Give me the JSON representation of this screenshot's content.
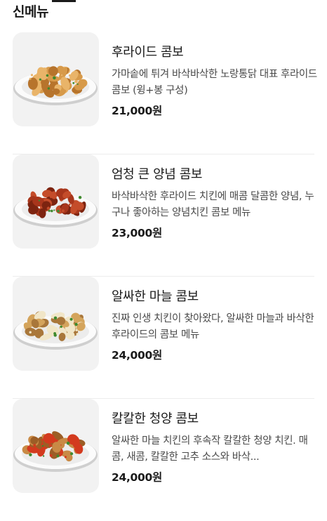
{
  "section": {
    "title": "신메뉴"
  },
  "menu": [
    {
      "name": "후라이드 콤보",
      "description": "가마솥에 튀겨 바삭바삭한 노랑통닭 대표 후라이드 콤보 (윙+봉 구성)",
      "price": "21,000원",
      "image": "fried-chicken-plate",
      "colors": {
        "main": "#d79a4a",
        "shade": "#b7742c",
        "accent": "#e9b469"
      }
    },
    {
      "name": "엄청 큰 양념 콤보",
      "description": "바삭바삭한 후라이드 치킨에 매콤 달콤한 양념, 누구나 좋아하는 양념치킨 콤보 메뉴",
      "price": "23,000원",
      "image": "seasoned-chicken-plate",
      "colors": {
        "main": "#a8361c",
        "shade": "#7d2410",
        "accent": "#c44c2a"
      }
    },
    {
      "name": "알싸한 마늘 콤보",
      "description": "진짜 인생 치킨이 찾아왔다, 알싸한 마늘과 바삭한 후라이드의 콤보 메뉴",
      "price": "24,000원",
      "image": "garlic-chicken-plate",
      "colors": {
        "main": "#d4a45c",
        "shade": "#a9773a",
        "accent": "#f1e6c8"
      }
    },
    {
      "name": "칼칼한 청양 콤보",
      "description": "알싸한 마늘 치킨의 후속작 칼칼한 청양 치킨. 매콤, 새콤, 칼칼한 고추 소스와 바삭...",
      "price": "24,000원",
      "image": "chili-chicken-plate",
      "colors": {
        "main": "#c98a45",
        "shade": "#9c5e26",
        "accent": "#d33a1e"
      }
    }
  ]
}
